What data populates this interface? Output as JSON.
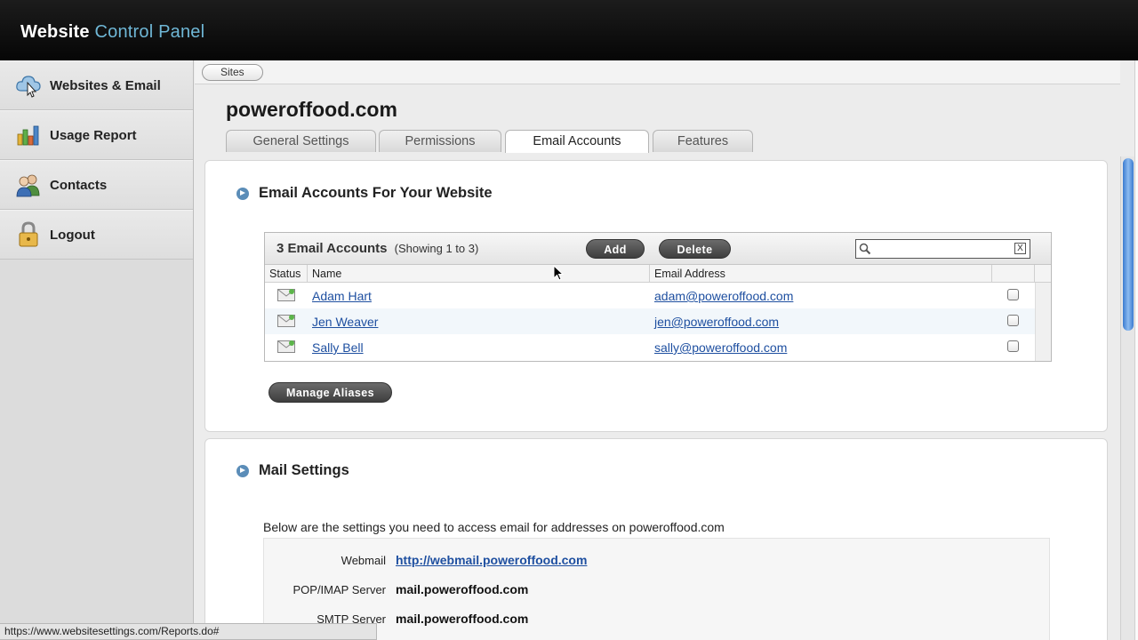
{
  "header": {
    "title_bold": "Website",
    "title_accent": "Control Panel"
  },
  "sidebar": {
    "items": [
      {
        "label": "Websites & Email",
        "icon": "cloud-cursor-icon"
      },
      {
        "label": "Usage Report",
        "icon": "bar-chart-icon"
      },
      {
        "label": "Contacts",
        "icon": "people-icon"
      },
      {
        "label": "Logout",
        "icon": "padlock-icon"
      }
    ]
  },
  "breadcrumb": {
    "label": "Sites"
  },
  "site": {
    "title": "poweroffood.com"
  },
  "tabs": [
    {
      "label": "General Settings"
    },
    {
      "label": "Permissions"
    },
    {
      "label": "Email Accounts",
      "active": true
    },
    {
      "label": "Features"
    }
  ],
  "accounts_section": {
    "title": "Email Accounts For Your Website",
    "count_label": "3 Email Accounts",
    "showing_label": "(Showing 1 to 3)",
    "add_label": "Add",
    "delete_label": "Delete",
    "search_value": "",
    "clear_label": "X",
    "columns": {
      "status": "Status",
      "name": "Name",
      "email": "Email Address"
    },
    "rows": [
      {
        "name": "Adam Hart",
        "email": "adam@poweroffood.com"
      },
      {
        "name": "Jen Weaver",
        "email": "jen@poweroffood.com"
      },
      {
        "name": "Sally Bell",
        "email": "sally@poweroffood.com"
      }
    ],
    "manage_label": "Manage Aliases"
  },
  "mail_section": {
    "title": "Mail Settings",
    "intro": "Below are the settings you need to access email for addresses on poweroffood.com",
    "settings": [
      {
        "key": "Webmail",
        "value": "http://webmail.poweroffood.com",
        "link": true
      },
      {
        "key": "POP/IMAP Server",
        "value": "mail.poweroffood.com"
      },
      {
        "key": "SMTP Server",
        "value": "mail.poweroffood.com"
      }
    ]
  },
  "statusbar": {
    "url": "https://www.websitesettings.com/Reports.do#"
  },
  "colors": {
    "accent": "#6fb7d6",
    "link": "#1e4fa0",
    "header_bg": "#0a0a0a"
  }
}
